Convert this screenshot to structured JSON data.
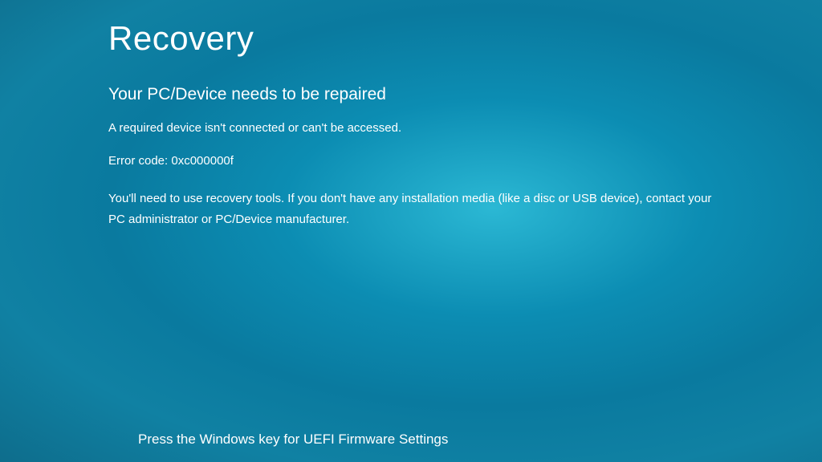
{
  "recovery": {
    "title": "Recovery",
    "subtitle": "Your PC/Device needs to be repaired",
    "message": "A required device isn't connected or can't be accessed.",
    "error_code": "Error code: 0xc000000f",
    "instructions": "You'll need to use recovery tools. If you don't have any installation media (like a disc or USB device), contact your PC administrator or PC/Device manufacturer.",
    "footer": "Press the Windows key for UEFI Firmware Settings"
  }
}
